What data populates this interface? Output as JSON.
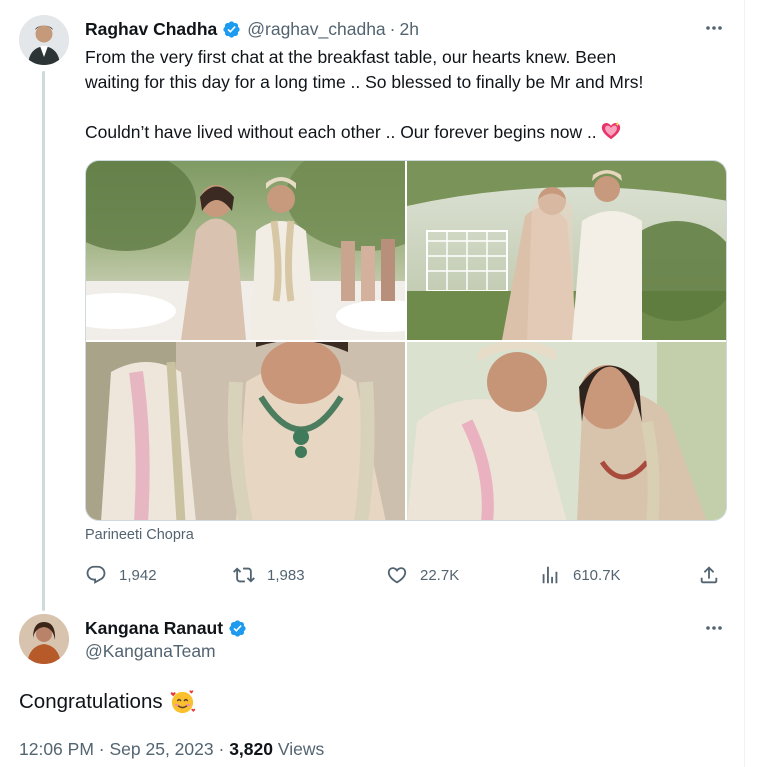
{
  "tweet": {
    "author_name": "Raghav Chadha",
    "handle": "@raghav_chadha",
    "separator": "·",
    "time": "2h",
    "text_line1": "From the very first chat at the breakfast table, our hearts knew. Been",
    "text_line2": "waiting for this day for a long time .. So blessed to finally be Mr and Mrs!",
    "text_line3": "Couldn’t have lived without each other .. Our forever begins now ..",
    "emoji": "sparkling-heart",
    "media_caption": "Parineeti Chopra",
    "stats": {
      "replies": "1,942",
      "retweets": "1,983",
      "likes": "22.7K",
      "views": "610.7K"
    }
  },
  "reply": {
    "author_name": "Kangana Ranaut",
    "handle": "@KanganaTeam",
    "text": "Congratulations",
    "emoji": "smiling-face-with-hearts",
    "time": "12:06 PM",
    "separator": "·",
    "date": "Sep 25, 2023",
    "views_count": "3,820",
    "views_label": "Views"
  },
  "colors": {
    "verified": "#1d9bf0",
    "secondary_text": "#536471",
    "primary_text": "#0f1419",
    "border": "#cfd9de"
  }
}
